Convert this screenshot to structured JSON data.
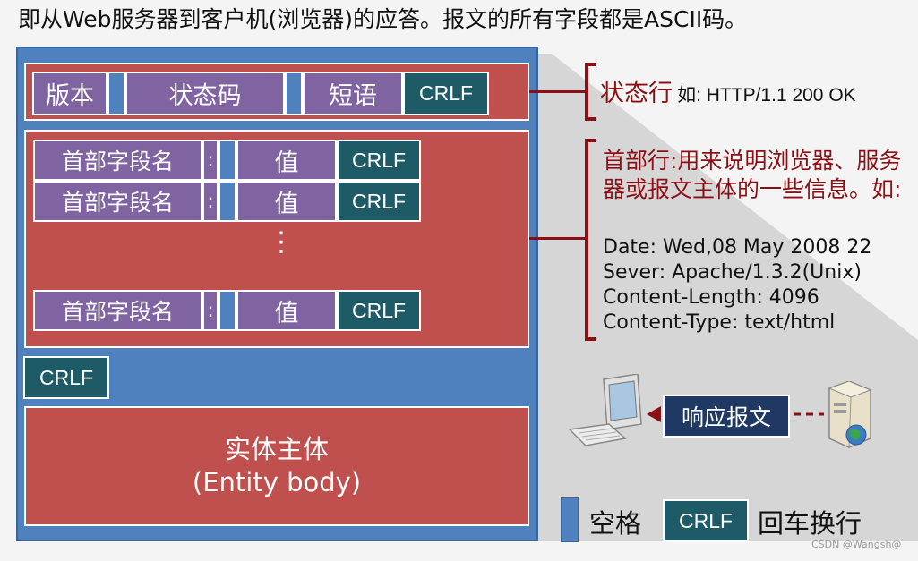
{
  "title": "即从Web服务器到客户机(浏览器)的应答。报文的所有字段都是ASCII码。",
  "status_line": {
    "version": "版本",
    "status_code": "状态码",
    "phrase": "短语",
    "crlf": "CRLF"
  },
  "header_rows": [
    {
      "name": "首部字段名",
      "colon": ":",
      "value": "值",
      "crlf": "CRLF"
    },
    {
      "name": "首部字段名",
      "colon": ":",
      "value": "值",
      "crlf": "CRLF"
    },
    {
      "name": "首部字段名",
      "colon": ":",
      "value": "值",
      "crlf": "CRLF"
    }
  ],
  "ellipsis": "⋮",
  "blank_crlf": "CRLF",
  "entity_body": {
    "line1": "实体主体",
    "line2": "(Entity body)"
  },
  "annotations": {
    "status_label": "状态行",
    "status_example": "如: HTTP/1.1 200 OK",
    "header_desc": "首部行:用来说明浏览器、服务器或报文主体的一些信息。如:",
    "header_examples": [
      "Date:  Wed,08 May 2008 22",
      "Sever:  Apache/1.3.2(Unix)",
      "Content-Length:  4096",
      "Content-Type:  text/html"
    ]
  },
  "response_label": "响应报文",
  "legend": {
    "space": "空格",
    "crlf_box": "CRLF",
    "crlf_meaning": "回车换行"
  },
  "watermark": "CSDN @Wangsh@",
  "colors": {
    "blue": "#4e81bd",
    "red": "#c0504e",
    "purple": "#8064a2",
    "teal": "#1f5b67",
    "dark_red": "#8b0f14"
  }
}
